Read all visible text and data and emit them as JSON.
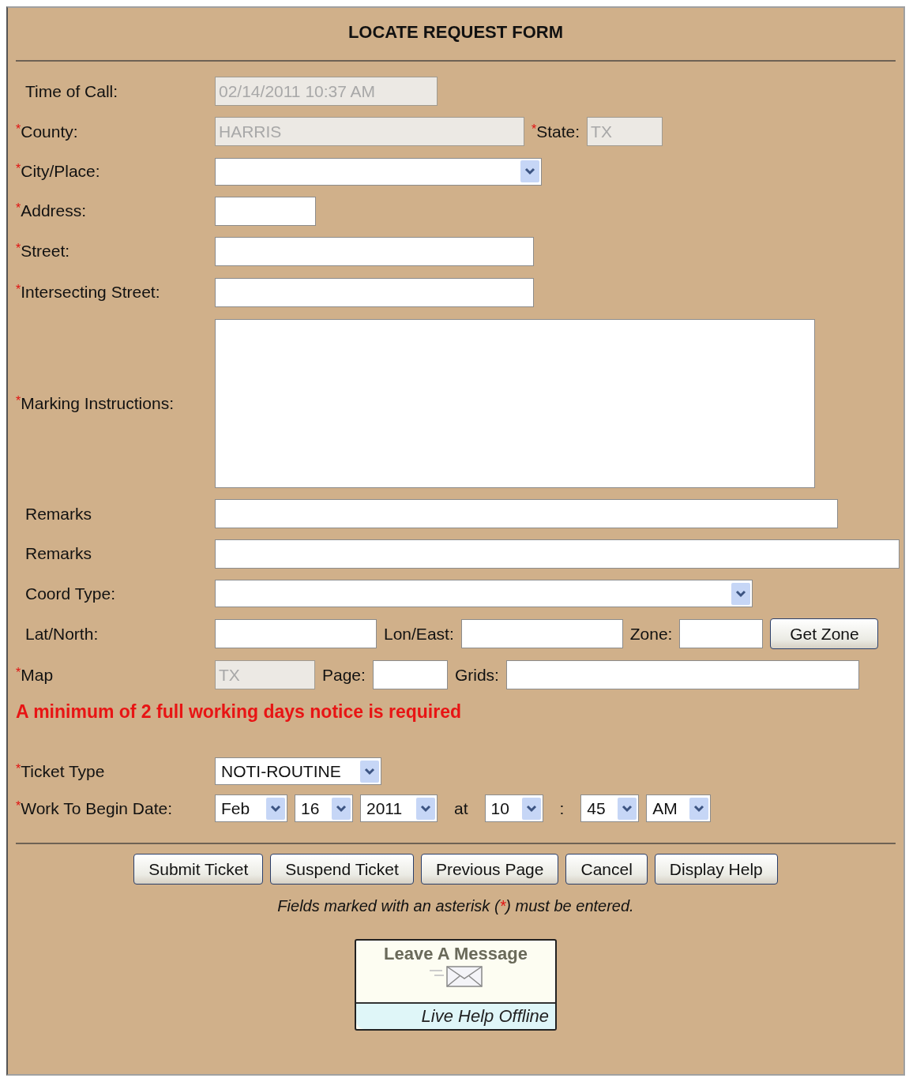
{
  "form": {
    "title": "LOCATE REQUEST FORM",
    "required_mark": "*",
    "rows": [
      {
        "label": "Time of Call:",
        "required": false,
        "controls": [
          {
            "kind": "text",
            "value": "02/14/2011 10:37 AM",
            "disabled": true
          }
        ]
      },
      {
        "label": "County:",
        "required": true,
        "controls": [
          {
            "kind": "text",
            "value": "HARRIS",
            "disabled": true
          },
          {
            "kind": "label",
            "text": "State:",
            "required": true
          },
          {
            "kind": "text",
            "value": "TX",
            "disabled": true
          }
        ]
      },
      {
        "label": "City/Place:",
        "required": true,
        "controls": [
          {
            "kind": "select"
          }
        ]
      },
      {
        "label": "Address:",
        "required": true,
        "controls": [
          {
            "kind": "text",
            "disabled": false
          }
        ]
      },
      {
        "label": "Street:",
        "required": true,
        "controls": [
          {
            "kind": "text",
            "disabled": false
          }
        ]
      },
      {
        "label": "Intersecting Street:",
        "required": true,
        "controls": [
          {
            "kind": "text",
            "disabled": false
          }
        ]
      },
      {
        "label": "Marking Instructions:",
        "required": true,
        "controls": [
          {
            "kind": "textarea"
          }
        ]
      },
      {
        "label": "Remarks",
        "required": false,
        "controls": [
          {
            "kind": "text",
            "disabled": false
          }
        ]
      },
      {
        "label": "Remarks",
        "required": false,
        "controls": [
          {
            "kind": "text",
            "disabled": false
          }
        ]
      },
      {
        "label": "Coord Type:",
        "required": false,
        "controls": [
          {
            "kind": "select"
          }
        ]
      },
      {
        "label": "Lat/North:",
        "required": false,
        "controls": [
          {
            "kind": "text",
            "disabled": false
          },
          {
            "kind": "label",
            "text": "Lon/East:",
            "required": false
          },
          {
            "kind": "text",
            "disabled": false
          },
          {
            "kind": "label",
            "text": "Zone:",
            "required": false
          },
          {
            "kind": "text",
            "disabled": false
          },
          {
            "kind": "button",
            "label": "Get Zone"
          }
        ]
      },
      {
        "label": "Map",
        "required": true,
        "controls": [
          {
            "kind": "text",
            "value": "TX",
            "disabled": true
          },
          {
            "kind": "label",
            "text": "Page:",
            "required": false
          },
          {
            "kind": "text",
            "disabled": false
          },
          {
            "kind": "label",
            "text": "Grids:",
            "required": false
          },
          {
            "kind": "text",
            "disabled": false
          }
        ]
      }
    ],
    "notice": "A minimum of 2 full working days notice is required",
    "schedule_rows": [
      {
        "label": "Ticket Type",
        "required": true,
        "controls": [
          {
            "kind": "select",
            "value": "NOTI-ROUTINE"
          }
        ]
      },
      {
        "label": "Work To Begin Date:",
        "required": true,
        "controls": [
          {
            "kind": "select",
            "value": "Feb"
          },
          {
            "kind": "select",
            "value": "16"
          },
          {
            "kind": "select",
            "value": "2011"
          },
          {
            "kind": "label",
            "text": "at",
            "required": false
          },
          {
            "kind": "select",
            "value": "10"
          },
          {
            "kind": "label",
            "text": ":",
            "required": false
          },
          {
            "kind": "select",
            "value": "45"
          },
          {
            "kind": "select",
            "value": "AM"
          }
        ]
      }
    ],
    "buttons": [
      "Submit Ticket",
      "Suspend Ticket",
      "Previous Page",
      "Cancel",
      "Display Help"
    ],
    "footnote": {
      "before": "Fields marked with an asterisk (",
      "after": ") must be entered."
    },
    "live_help": {
      "heading": "Leave A Message",
      "status": "Live Help Offline"
    }
  }
}
